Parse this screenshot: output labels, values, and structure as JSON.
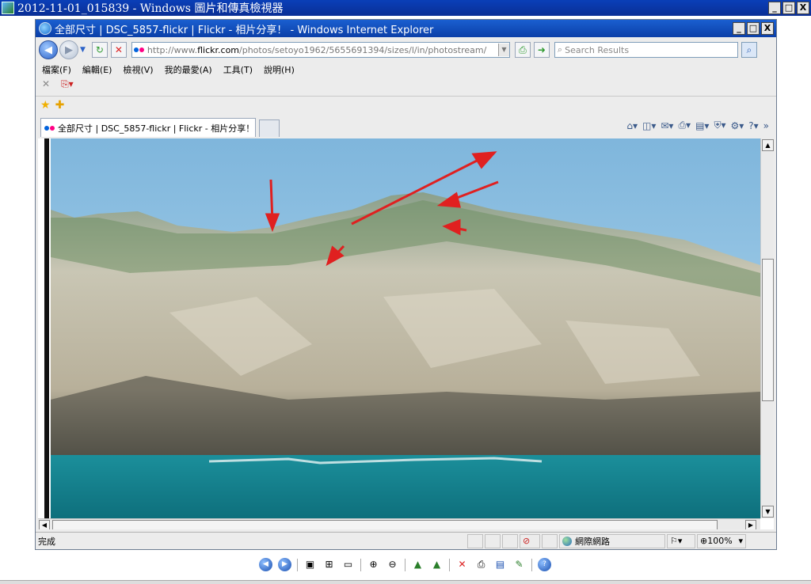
{
  "viewer": {
    "title": "2012-11-01_015839 - Windows 圖片和傳真檢視器",
    "controls": {
      "minimize": "_",
      "maximize": "□",
      "close": "X"
    }
  },
  "browser": {
    "title": "全部尺寸 | DSC_5857-flickr | Flickr - 相片分享！ - Windows Internet Explorer",
    "url_prefix": "http://www.",
    "url_host": "flickr.com",
    "url_path": "/photos/setoyo1962/5655691394/sizes/l/in/photostream/",
    "search_placeholder": "Search Results",
    "menu": [
      "檔案(F)",
      "編輯(E)",
      "檢視(V)",
      "我的最愛(A)",
      "工具(T)",
      "說明(H)"
    ],
    "tab_label": "全部尺寸 | DSC_5857-flickr | Flickr - 相片分享！",
    "status_text": "完成",
    "zone_label": "網際網路",
    "zoom_label": "100%"
  },
  "photo": {
    "arrow_color": "#e02020",
    "sky_color": "#8fc2e6",
    "sea_color": "#1a8f9a"
  }
}
